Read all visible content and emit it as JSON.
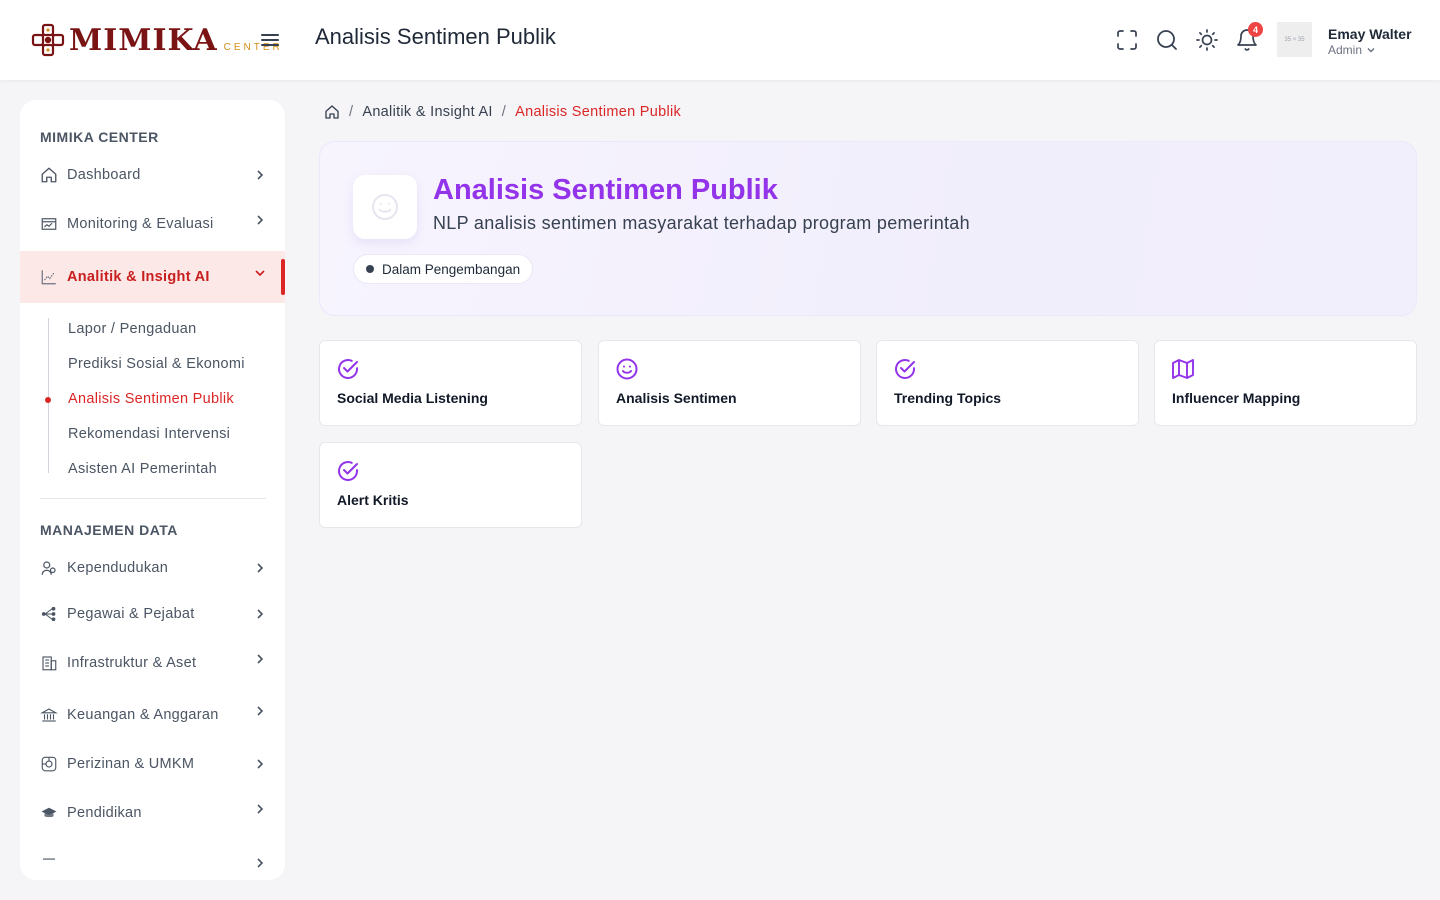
{
  "brand": {
    "name": "MIMIKA",
    "sub": "CENTER",
    "primary": "#7a1414",
    "accent": "#d4911b"
  },
  "header": {
    "title": "Analisis Sentimen Publik",
    "notif_count": "4",
    "avatar_text": "35 × 35",
    "user_name": "Emay Walter",
    "user_role": "Admin"
  },
  "sidebar": {
    "section1": "MIMIKA CENTER",
    "items": [
      {
        "label": "Dashboard",
        "icon": "home-icon"
      },
      {
        "label": "Monitoring & Evaluasi",
        "icon": "monitor-icon"
      },
      {
        "label": "Analitik & Insight AI",
        "icon": "chart-icon",
        "active": true
      }
    ],
    "subitems": [
      {
        "label": "Lapor / Pengaduan"
      },
      {
        "label": "Prediksi Sosial & Ekonomi"
      },
      {
        "label": "Analisis Sentimen Publik",
        "active": true
      },
      {
        "label": "Rekomendasi Intervensi"
      },
      {
        "label": "Asisten AI Pemerintah"
      }
    ],
    "section2": "MANAJEMEN DATA",
    "items2": [
      {
        "label": "Kependudukan",
        "icon": "users-icon"
      },
      {
        "label": "Pegawai & Pejabat",
        "icon": "org-icon"
      },
      {
        "label": "Infrastruktur & Aset",
        "icon": "building-icon"
      },
      {
        "label": "Keuangan & Anggaran",
        "icon": "bank-icon"
      },
      {
        "label": "Perizinan & UMKM",
        "icon": "license-icon"
      },
      {
        "label": "Pendidikan",
        "icon": "graduation-icon"
      }
    ]
  },
  "breadcrumb": {
    "home": "home-icon",
    "parent": "Analitik & Insight AI",
    "current": "Analisis Sentimen Publik"
  },
  "hero": {
    "title": "Analisis Sentimen Publik",
    "subtitle": "NLP analisis sentimen masyarakat terhadap program pemerintah",
    "status": "Dalam Pengembangan",
    "title_color": "#9333ea"
  },
  "features": [
    {
      "label": "Social Media Listening",
      "icon": "check-circle-icon"
    },
    {
      "label": "Analisis Sentimen",
      "icon": "smile-icon"
    },
    {
      "label": "Trending Topics",
      "icon": "check-circle-icon"
    },
    {
      "label": "Influencer Mapping",
      "icon": "map-icon"
    },
    {
      "label": "Alert Kritis",
      "icon": "check-circle-icon"
    }
  ]
}
